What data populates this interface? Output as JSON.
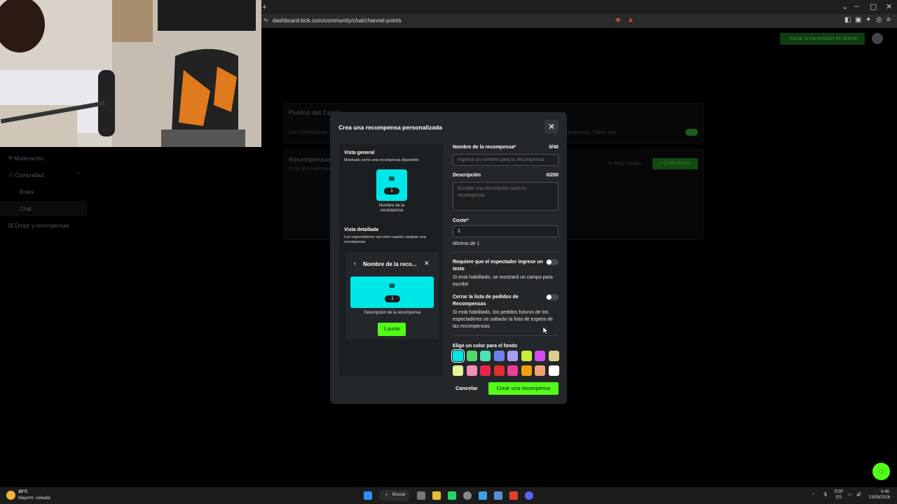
{
  "browser": {
    "new_tab": "+",
    "url": "dashboard.kick.com/community/chat/channel-points",
    "window_controls": [
      "⌄",
      "–",
      "▢",
      "✕"
    ]
  },
  "backdrop": {
    "top_button": "Iniciar la transmisión en directo",
    "sidebar": [
      {
        "label": "Moderación",
        "icon": "shield-icon"
      },
      {
        "label": "Comunidad",
        "icon": "users-icon"
      },
      {
        "label": "Roles",
        "icon": ""
      },
      {
        "label": "Chat",
        "icon": ""
      },
      {
        "label": "Drops y recompensas",
        "icon": "gift-icon"
      }
    ],
    "card1_title": "Puntos del Canal",
    "card1_text": "Los espectadores",
    "card1_text_right": "ompensas. Saber más",
    "card2_title": "Recompensas",
    "card2_sub": "Crea recompensas",
    "request_list": "Pedir listado",
    "create_new": "Crear nuevo"
  },
  "modal": {
    "title": "Crea una recompensa personalizada",
    "close": "✕",
    "overview_title": "Vista general",
    "overview_sub": "Mostrado como una recompensa disponible",
    "tile_cost": "1",
    "tile_name": "Nombre de la recompensa",
    "detail_title": "Vista detallada",
    "detail_sub": "Los espectadores ven esto cuando canjean una recompensa",
    "detail_header": "Nombre de la reco...",
    "detail_desc": "Descripción de la recompensa",
    "detail_points_btn": "1 punto",
    "name_label": "Nombre de la recompensa*",
    "name_count": "0/40",
    "name_placeholder": "Ingresa un nombre para tu recompensa",
    "desc_label": "Descripción",
    "desc_count": "0/200",
    "desc_placeholder": "Escribe una descripción para tu recompensa",
    "cost_label": "Costo*",
    "cost_value": "1",
    "cost_help": "Mínimo de 1",
    "require_text_label": "Requiere que el espectador ingrese un texto",
    "require_text_help": "Si está habilitado, se mostrará un campo para escribir",
    "close_queue_label": "Cerrar la lista de pedidos de Recompensas",
    "close_queue_help": "Si está habilitado, los pedidos futuros de los espectadores se saltarán la lista de espera de las recompensas",
    "color_label": "Elige un color para el fondo",
    "colors_row1": [
      "#00e7e7",
      "#53d769",
      "#4be3b3",
      "#6e7ff2",
      "#a89cf7",
      "#c7ef3a",
      "#d24bf0",
      "#dccd8c"
    ],
    "colors_row2": [
      "#e4f59a",
      "#f38dbb",
      "#e8254d",
      "#e22d2d",
      "#ea3f95",
      "#f0a10a",
      "#f2a274",
      "#ffffff"
    ],
    "cancel": "Cancelar",
    "create": "Crear una recompensa"
  },
  "taskbar": {
    "weather_temp": "26°C",
    "weather_desc": "Mayorm. soleado",
    "search": "Buscar",
    "lang1": "ESP",
    "lang2": "ES",
    "time": "9:46",
    "date": "23/08/2026"
  }
}
